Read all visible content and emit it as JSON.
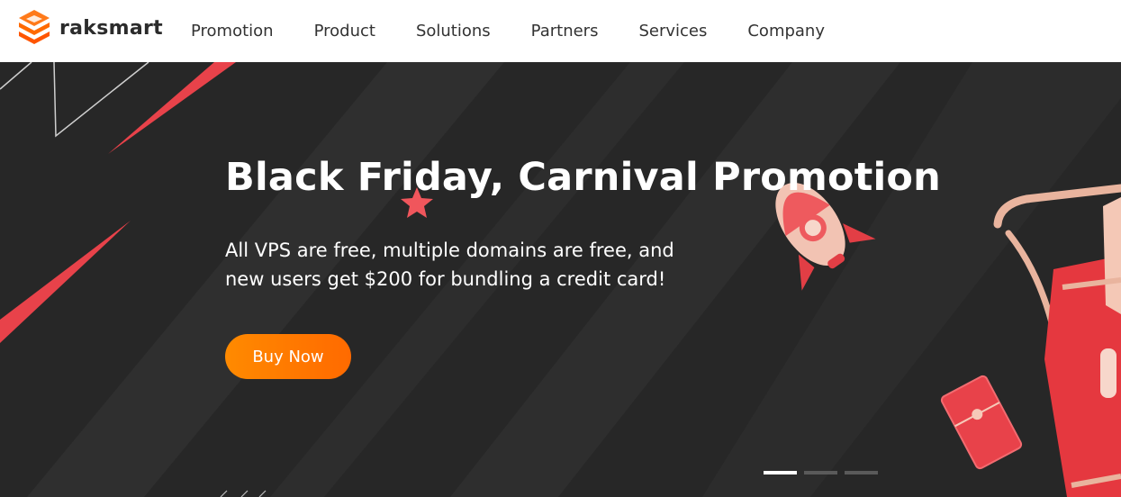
{
  "brand": {
    "name": "raksmart",
    "accent": "#ff6a00"
  },
  "nav": {
    "items": [
      {
        "label": "Promotion"
      },
      {
        "label": "Product"
      },
      {
        "label": "Solutions"
      },
      {
        "label": "Partners"
      },
      {
        "label": "Services"
      },
      {
        "label": "Company"
      }
    ]
  },
  "hero": {
    "title": "Black Friday, Carnival Promotion",
    "subtitle_line1": "All VPS are free, multiple domains are free, and",
    "subtitle_line2": "new users get $200 for bundling a credit card!",
    "cta_label": "Buy Now",
    "background_color": "#272727",
    "decoration_color": "#e8424a",
    "slides": {
      "count": 3,
      "active_index": 0
    }
  }
}
